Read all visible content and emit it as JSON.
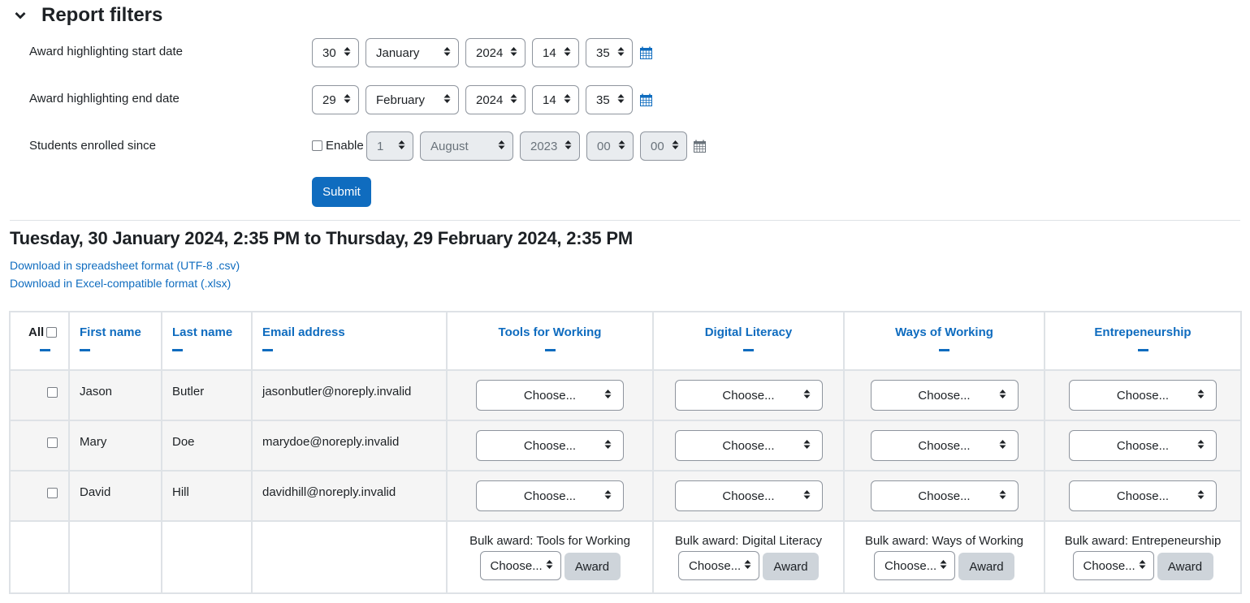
{
  "filters": {
    "title": "Report filters",
    "start": {
      "label": "Award highlighting start date",
      "day": "30",
      "month": "January",
      "year": "2024",
      "hour": "14",
      "minute": "35"
    },
    "end": {
      "label": "Award highlighting end date",
      "day": "29",
      "month": "February",
      "year": "2024",
      "hour": "14",
      "minute": "35"
    },
    "enrolled": {
      "label": "Students enrolled since",
      "enable_label": "Enable",
      "enabled": false,
      "day": "1",
      "month": "August",
      "year": "2023",
      "hour": "00",
      "minute": "00"
    },
    "submit_label": "Submit"
  },
  "range_title": "Tuesday, 30 January 2024, 2:35 PM to Thursday, 29 February 2024, 2:35 PM",
  "downloads": [
    "Download in spreadsheet format (UTF-8 .csv)",
    "Download in Excel-compatible format (.xlsx)"
  ],
  "table": {
    "all_label": "All",
    "columns": [
      "First name",
      "Last name",
      "Email address",
      "Tools for Working",
      "Digital Literacy",
      "Ways of Working",
      "Entrepeneurship"
    ],
    "rows": [
      {
        "first": "Jason",
        "last": "Butler",
        "email": "jasonbutler@noreply.invalid",
        "awards": [
          "Choose...",
          "Choose...",
          "Choose...",
          "Choose..."
        ]
      },
      {
        "first": "Mary",
        "last": "Doe",
        "email": "marydoe@noreply.invalid",
        "awards": [
          "Choose...",
          "Choose...",
          "Choose...",
          "Choose..."
        ]
      },
      {
        "first": "David",
        "last": "Hill",
        "email": "davidhill@noreply.invalid",
        "awards": [
          "Choose...",
          "Choose...",
          "Choose...",
          "Choose..."
        ]
      }
    ],
    "bulk": [
      {
        "label": "Bulk award: Tools for Working",
        "select": "Choose...",
        "button": "Award"
      },
      {
        "label": "Bulk award: Digital Literacy",
        "select": "Choose...",
        "button": "Award"
      },
      {
        "label": "Bulk award: Ways of Working",
        "select": "Choose...",
        "button": "Award"
      },
      {
        "label": "Bulk award: Entrepeneurship",
        "select": "Choose...",
        "button": "Award"
      }
    ]
  },
  "colors": {
    "accent": "#0f6cbf",
    "text": "#1d2125",
    "border": "#dee2e6",
    "row_bg": "#f5f5f5",
    "award_btn": "#ced4da"
  }
}
